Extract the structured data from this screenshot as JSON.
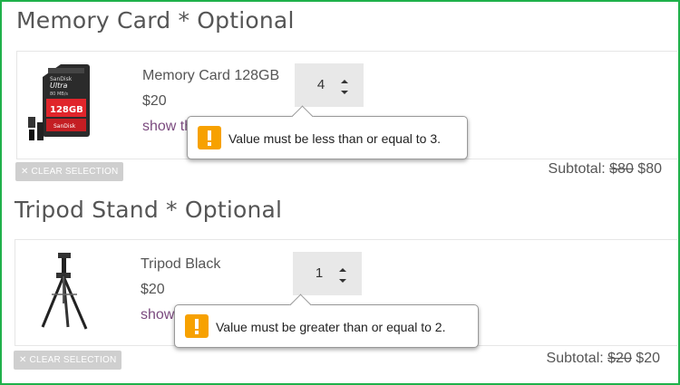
{
  "sections": [
    {
      "title": "Memory Card * Optional",
      "product": {
        "name": "Memory Card 128GB",
        "price": "$20",
        "link_label": "show th",
        "image_label": "sandisk-sd-card-image",
        "image_text": "128GB",
        "image_brand": "SanDisk"
      },
      "quantity": "4",
      "tooltip": "Value must be less than or equal to 3.",
      "clear_label": "✕ CLEAR SELECTION",
      "subtotal_label": "Subtotal:",
      "subtotal_old": "$80",
      "subtotal_new": "$80"
    },
    {
      "title": "Tripod Stand * Optional",
      "product": {
        "name": "Tripod Black",
        "price": "$20",
        "link_label": "show",
        "image_label": "tripod-image"
      },
      "quantity": "1",
      "tooltip": "Value must be greater than or equal to 2.",
      "clear_label": "✕ CLEAR SELECTION",
      "subtotal_label": "Subtotal:",
      "subtotal_old": "$20",
      "subtotal_new": "$20"
    }
  ],
  "colors": {
    "frame": "#1fb14a",
    "warning": "#f7a100",
    "link": "#7b4a7f",
    "clear_button": "#cfcfcf"
  }
}
